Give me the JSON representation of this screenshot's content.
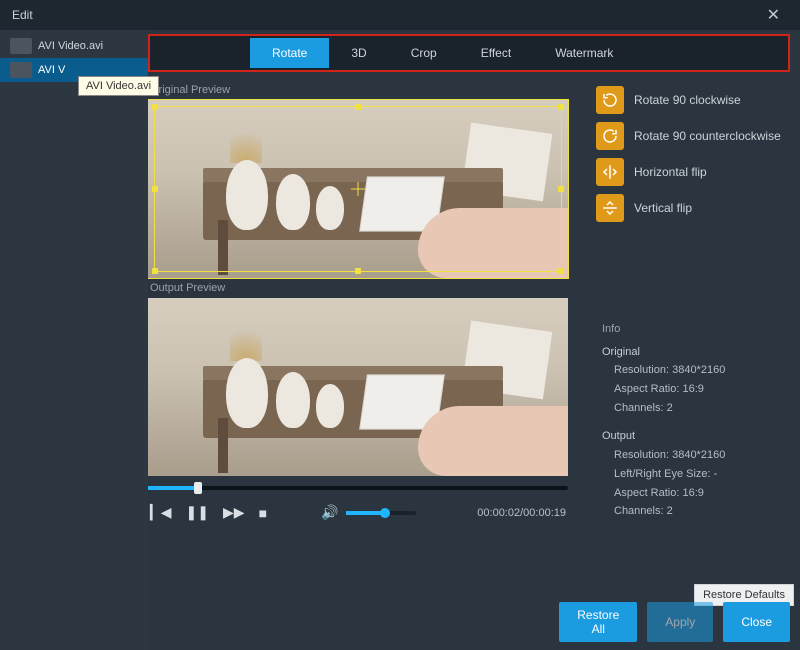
{
  "window": {
    "title": "Edit"
  },
  "sidebar": {
    "files": [
      {
        "name": "AVI Video.avi",
        "active": false
      },
      {
        "name": "AVI V",
        "active": true
      }
    ],
    "tooltip": "AVI Video.avi"
  },
  "tabs": [
    {
      "label": "Rotate",
      "active": true
    },
    {
      "label": "3D",
      "active": false
    },
    {
      "label": "Crop",
      "active": false
    },
    {
      "label": "Effect",
      "active": false
    },
    {
      "label": "Watermark",
      "active": false
    }
  ],
  "previews": {
    "original_label": "Original Preview",
    "output_label": "Output Preview"
  },
  "playback": {
    "position_pct": 12,
    "volume_pct": 55,
    "current_time": "00:00:02",
    "total_time": "00:00:19"
  },
  "rotate_options": [
    {
      "id": "rotate-cw",
      "label": "Rotate 90 clockwise"
    },
    {
      "id": "rotate-ccw",
      "label": "Rotate 90 counterclockwise"
    },
    {
      "id": "flip-h",
      "label": "Horizontal flip"
    },
    {
      "id": "flip-v",
      "label": "Vertical flip"
    }
  ],
  "info": {
    "header": "Info",
    "original": {
      "title": "Original",
      "resolution": "Resolution: 3840*2160",
      "aspect": "Aspect Ratio: 16:9",
      "channels": "Channels: 2"
    },
    "output": {
      "title": "Output",
      "resolution": "Resolution: 3840*2160",
      "eyesize": "Left/Right Eye Size: -",
      "aspect": "Aspect Ratio: 16:9",
      "channels": "Channels: 2"
    }
  },
  "buttons": {
    "restore_defaults": "Restore Defaults",
    "restore_all": "Restore All",
    "apply": "Apply",
    "close": "Close"
  }
}
